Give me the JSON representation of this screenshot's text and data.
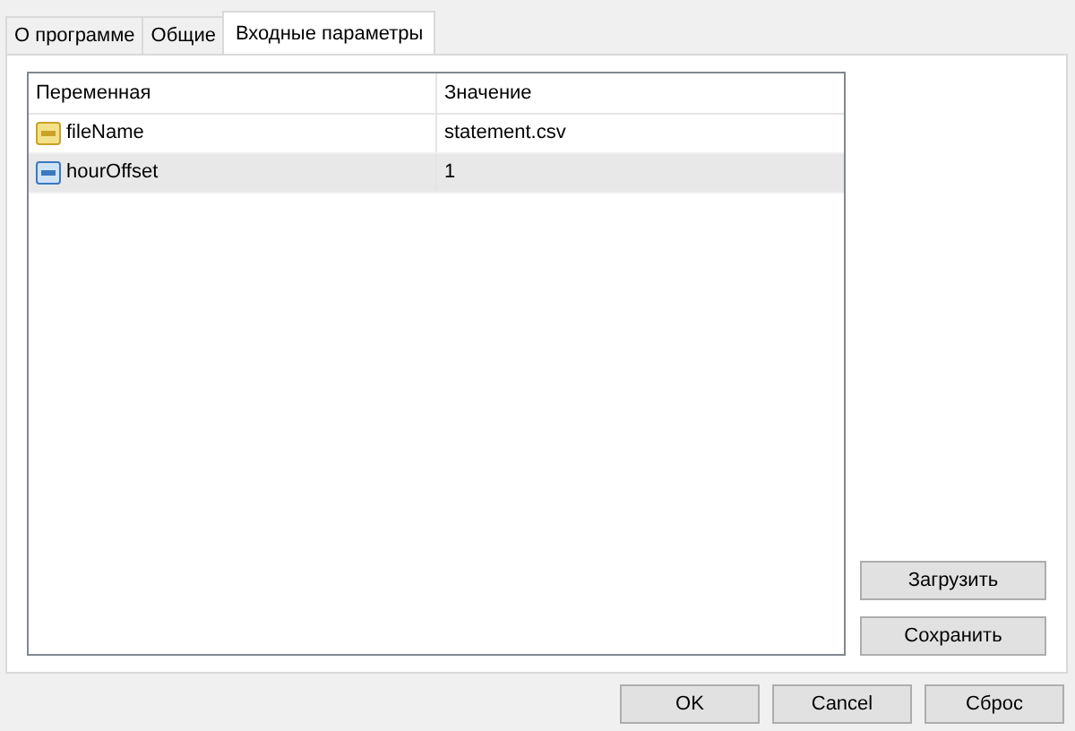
{
  "tabs": [
    {
      "label": "О программе",
      "selected": false
    },
    {
      "label": "Общие",
      "selected": false
    },
    {
      "label": "Входные параметры",
      "selected": true
    }
  ],
  "table": {
    "columns": [
      "Переменная",
      "Значение"
    ],
    "rows": [
      {
        "kind": "string",
        "variable": "fileName",
        "value": "statement.csv",
        "selected": false
      },
      {
        "kind": "integer",
        "variable": "hourOffset",
        "value": "1",
        "selected": true
      }
    ]
  },
  "side_buttons": [
    "Загрузить",
    "Сохранить"
  ],
  "buttons": [
    "OK",
    "Cancel",
    "Сброс"
  ]
}
